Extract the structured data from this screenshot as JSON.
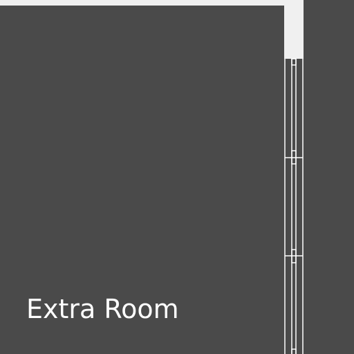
{
  "room": {
    "name": "Extra Room"
  },
  "colors": {
    "background": "#4a4a4a",
    "wall": "#f0f0f0",
    "line": "#ffffff"
  }
}
